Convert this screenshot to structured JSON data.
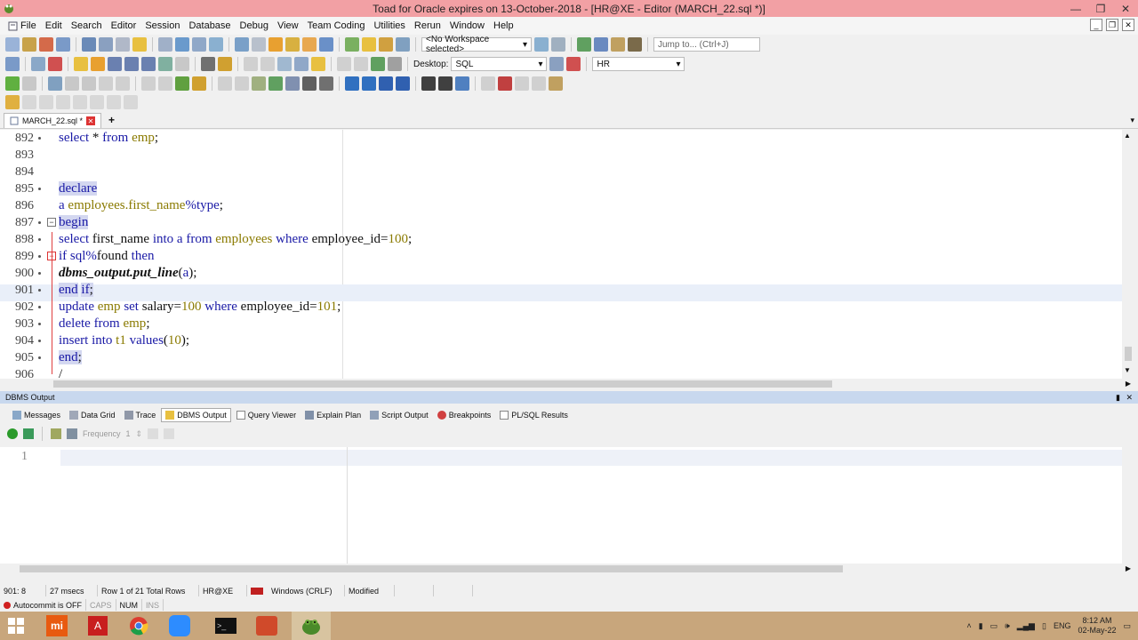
{
  "window": {
    "title": "Toad for Oracle expires on 13-October-2018 - [HR@XE - Editor (MARCH_22.sql *)]"
  },
  "menu": [
    "File",
    "Edit",
    "Search",
    "Editor",
    "Session",
    "Database",
    "Debug",
    "View",
    "Team Coding",
    "Utilities",
    "Rerun",
    "Window",
    "Help"
  ],
  "toolbar": {
    "workspace": "<No Workspace selected>",
    "jump_placeholder": "Jump to... (Ctrl+J)",
    "desktop_label": "Desktop:",
    "desktop_value": "SQL",
    "connection": "HR",
    "frequency_label": "Frequency",
    "frequency_value": "1"
  },
  "editor_tab": {
    "label": "MARCH_22.sql *",
    "add": "+"
  },
  "editor": {
    "lines": [
      {
        "num": "892",
        "dot": "•",
        "fold": "",
        "text": "select * from emp;"
      },
      {
        "num": "893",
        "dot": "",
        "fold": "",
        "text": ""
      },
      {
        "num": "894",
        "dot": "",
        "fold": "",
        "text": ""
      },
      {
        "num": "895",
        "dot": "•",
        "fold": "",
        "text": "declare"
      },
      {
        "num": "896",
        "dot": "",
        "fold": "",
        "text": "a employees.first_name%type;"
      },
      {
        "num": "897",
        "dot": "•",
        "fold": "⊟",
        "text": "begin"
      },
      {
        "num": "898",
        "dot": "•",
        "fold": "",
        "text": "select first_name into a from employees where employee_id=100;"
      },
      {
        "num": "899",
        "dot": "•",
        "fold": "⊟",
        "text": "if sql%found then"
      },
      {
        "num": "900",
        "dot": "•",
        "fold": "",
        "text": "dbms_output.put_line(a);"
      },
      {
        "num": "901",
        "dot": "•",
        "fold": "",
        "text": "end if;"
      },
      {
        "num": "902",
        "dot": "•",
        "fold": "",
        "text": "update emp set salary=100 where employee_id=101;"
      },
      {
        "num": "903",
        "dot": "•",
        "fold": "",
        "text": "delete from emp;"
      },
      {
        "num": "904",
        "dot": "•",
        "fold": "",
        "text": "insert into t1 values(10);"
      },
      {
        "num": "905",
        "dot": "•",
        "fold": "",
        "text": "end;"
      },
      {
        "num": "906",
        "dot": "",
        "fold": "",
        "text": "/"
      }
    ]
  },
  "output_panel": {
    "title": "DBMS Output",
    "tabs": [
      "Messages",
      "Data Grid",
      "Trace",
      "DBMS Output",
      "Query Viewer",
      "Explain Plan",
      "Script Output",
      "Breakpoints",
      "PL/SQL Results"
    ],
    "active_tab": "DBMS Output",
    "line_number": "1"
  },
  "status": {
    "cursor": "901:  8",
    "time": "27 msecs",
    "rows": "Row 1 of 21 Total Rows",
    "connection": "HR@XE",
    "line_endings": "Windows (CRLF)",
    "modified": "Modified",
    "autocommit": "Autocommit is OFF",
    "caps": "CAPS",
    "num": "NUM",
    "ins": "INS"
  },
  "taskbar": {
    "time": "8:12 AM",
    "date": "02-May-22",
    "lang": "ENG"
  },
  "colors": {
    "titlebar": "#f2a0a4",
    "keyword": "#1a1aa6",
    "table": "#8a7a00",
    "taskbar": "#c8a67c"
  }
}
